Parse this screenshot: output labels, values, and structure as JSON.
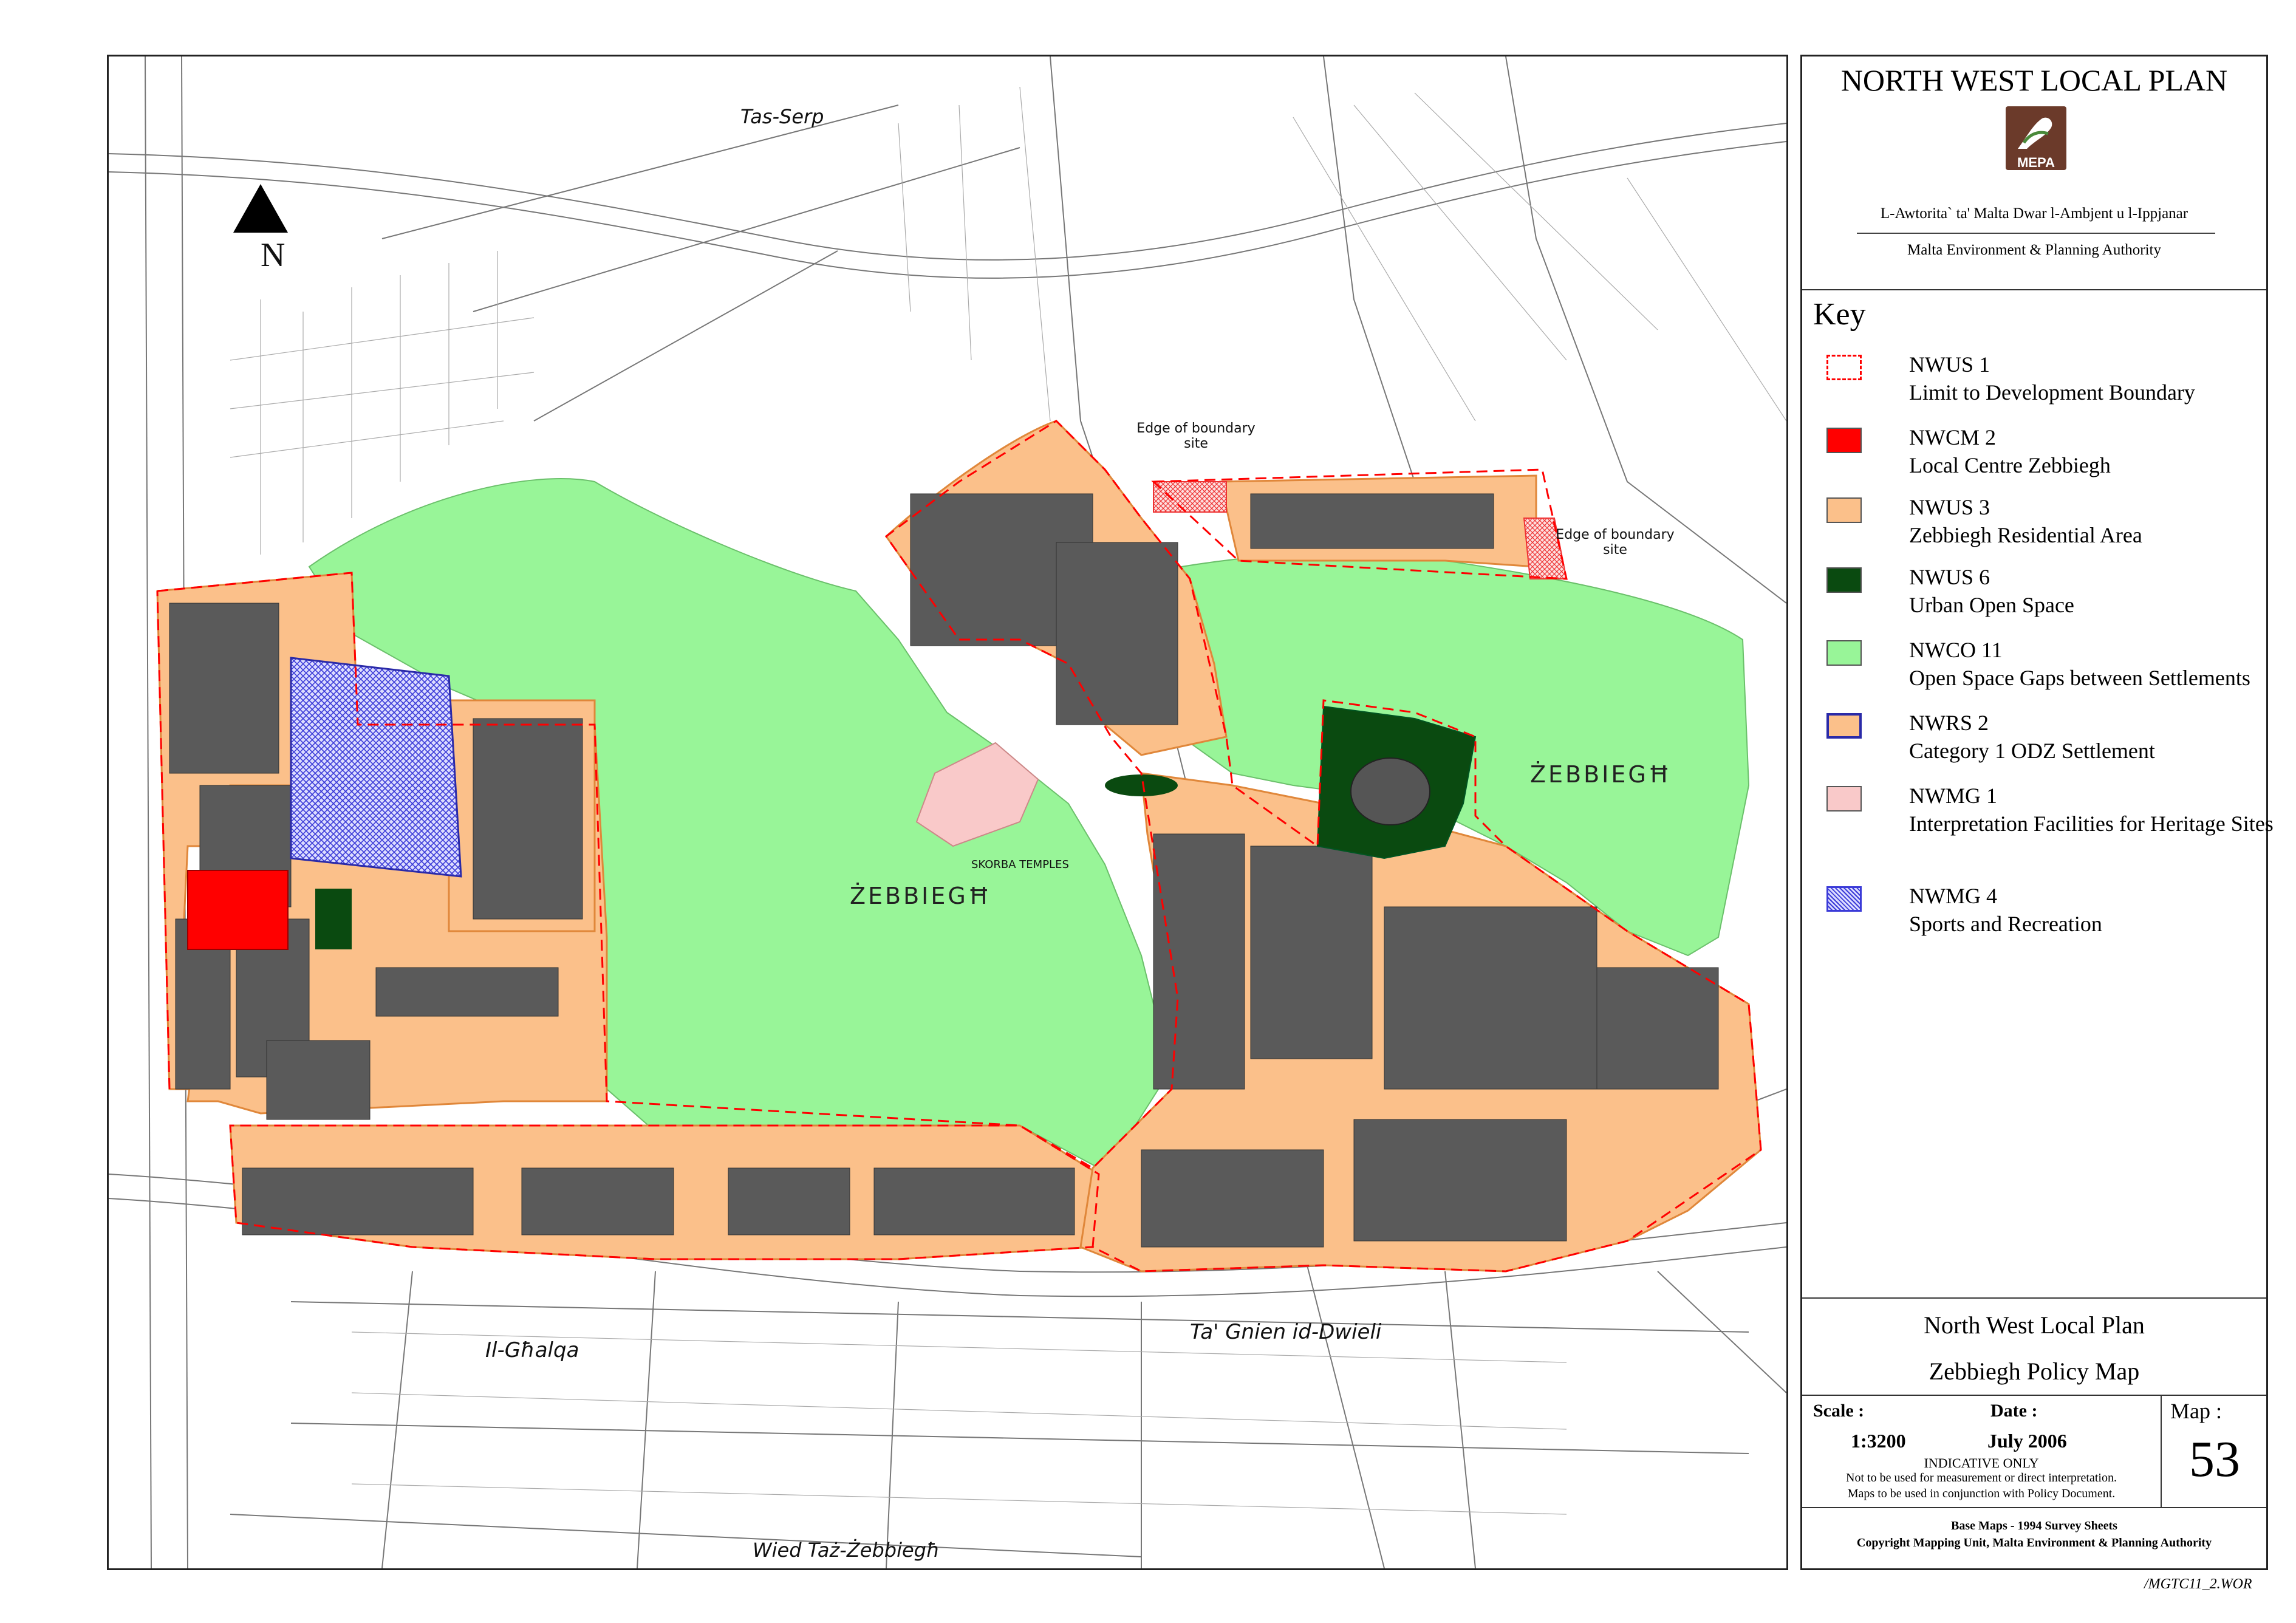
{
  "header": {
    "title": "NORTH WEST LOCAL PLAN",
    "logo_text": "MEPA",
    "authority_maltese": "L-Awtorita` ta' Malta Dwar l-Ambjent u l-Ippjanar",
    "authority_english": "Malta Environment & Planning Authority"
  },
  "key": {
    "heading": "Key",
    "items": [
      {
        "code": "NWUS 1",
        "desc": "Limit to Development Boundary",
        "color": "#ff0000",
        "style": "dashed"
      },
      {
        "code": "NWCM 2",
        "desc": "Local Centre Zebbiegh",
        "color": "#ff0000",
        "style": "fill"
      },
      {
        "code": "NWUS 3",
        "desc": "Zebbiegh Residential Area",
        "color": "#fbc08a",
        "style": "fill"
      },
      {
        "code": "NWUS 6",
        "desc": "Urban Open Space",
        "color": "#0a4a10",
        "style": "fill"
      },
      {
        "code": "NWCO 11",
        "desc": "Open Space Gaps between Settlements",
        "color": "#98f598",
        "style": "fill"
      },
      {
        "code": "NWRS 2",
        "desc": "Category 1 ODZ Settlement",
        "color": "#fbc08a",
        "style": "outlined",
        "outline": "#2a2aa8"
      },
      {
        "code": "NWMG 1",
        "desc": "Interpretation Facilities for Heritage Sites",
        "color": "#f9c9c9",
        "style": "fill"
      },
      {
        "code": "NWMG 4",
        "desc": "Sports and Recreation",
        "color": "#3b3bd8",
        "style": "hatched"
      }
    ]
  },
  "plan": {
    "name": "North West Local Plan",
    "map_title": "Zebbiegh Policy Map",
    "scale_label": "Scale :",
    "scale_value": "1:3200",
    "date_label": "Date :",
    "date_value": "July 2006",
    "map_label": "Map :",
    "map_number": "53",
    "indicative": "INDICATIVE ONLY",
    "note1": "Not to be used for measurement or direct interpretation.",
    "note2": "Maps to be used in conjunction with Policy Document.",
    "base_maps": "Base Maps - 1994 Survey Sheets",
    "copyright": "Copyright Mapping Unit, Malta Environment & Planning Authority"
  },
  "file_ref": "/MGTC11_2.WOR",
  "map_labels": {
    "north": "N",
    "tas_serp": "Tas-Serp",
    "zebbiegh_west": "ŻEBBIEGĦ",
    "zebbiegh_east": "ŻEBBIEGĦ",
    "skorba": "SKORBA TEMPLES",
    "il_ghalqa": "Il-Għalqa",
    "ta_gnien": "Ta' Gnien id-Dwieli",
    "wied": "Wied Taż-Żebbiegħ",
    "edge1": "Edge of boundary",
    "edge1b": "site",
    "edge2": "Edge of boundary",
    "edge2b": "site"
  }
}
